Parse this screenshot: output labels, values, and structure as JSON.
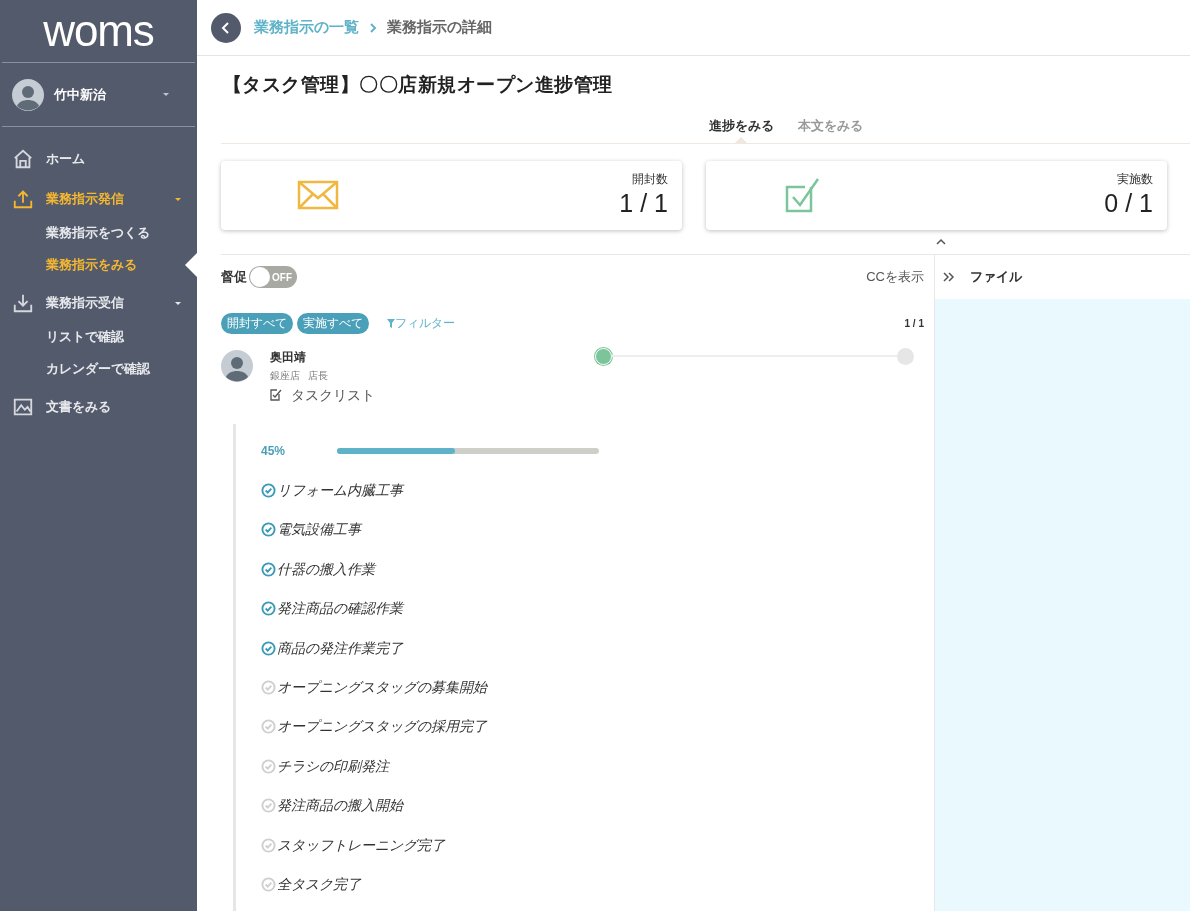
{
  "sidebar": {
    "logo": "woms",
    "user": {
      "name": "竹中新治"
    },
    "items": [
      {
        "kind": "home",
        "label": "ホーム",
        "selected": false
      },
      {
        "kind": "send",
        "label": "業務指示発信",
        "selected": true,
        "expanded": true,
        "children": [
          {
            "label": "業務指示をつくる",
            "selected": false
          },
          {
            "label": "業務指示をみる",
            "selected": true
          }
        ]
      },
      {
        "kind": "receive",
        "label": "業務指示受信",
        "selected": false,
        "expanded": true,
        "children": [
          {
            "label": "リストで確認",
            "selected": false
          },
          {
            "label": "カレンダーで確認",
            "selected": false
          }
        ]
      },
      {
        "kind": "docs",
        "label": "文書をみる",
        "selected": false
      }
    ]
  },
  "breadcrumb": [
    {
      "label": "業務指示の一覧",
      "kind": "link"
    },
    {
      "label": "業務指示の詳細",
      "kind": "current"
    }
  ],
  "title": "【タスク管理】〇〇店新規オープン進捗管理",
  "tabs": [
    {
      "label": "進捗をみる",
      "selected": true
    },
    {
      "label": "本文をみる",
      "selected": false
    }
  ],
  "stats": [
    {
      "kind": "open",
      "label": "開封数",
      "value": "1 / 1"
    },
    {
      "kind": "done",
      "label": "実施数",
      "value": "0 / 1"
    }
  ],
  "reminder": {
    "label": "督促",
    "on": false,
    "state_text": "OFF"
  },
  "cc_link": "CCを表示",
  "filters": [
    "開封すべて",
    "実施すべて"
  ],
  "filter_link": "フィルター",
  "count": "1 / 1",
  "recipient": {
    "name": "奥田靖",
    "store": "銀座店",
    "role": "店長",
    "steps": [
      {
        "done": true
      },
      {
        "done": false
      }
    ],
    "tasklist_label": "タスクリスト",
    "progress_text": "45%",
    "level": 0.45,
    "tasks": [
      {
        "label": "リフォーム内臓工事",
        "checked": true
      },
      {
        "label": "電気設備工事",
        "checked": true
      },
      {
        "label": "什器の搬入作業",
        "checked": true
      },
      {
        "label": "発注商品の確認作業",
        "checked": true
      },
      {
        "label": "商品の発注作業完了",
        "checked": true
      },
      {
        "label": "オープニングスタッグの募集開始",
        "checked": false
      },
      {
        "label": "オープニングスタッグの採用完了",
        "checked": false
      },
      {
        "label": "チラシの印刷発注",
        "checked": false
      },
      {
        "label": "発注商品の搬入開始",
        "checked": false
      },
      {
        "label": "スタッフトレーニング完了",
        "checked": false
      },
      {
        "label": "全タスク完了",
        "checked": false
      }
    ]
  },
  "file_panel": {
    "title": "ファイル"
  }
}
